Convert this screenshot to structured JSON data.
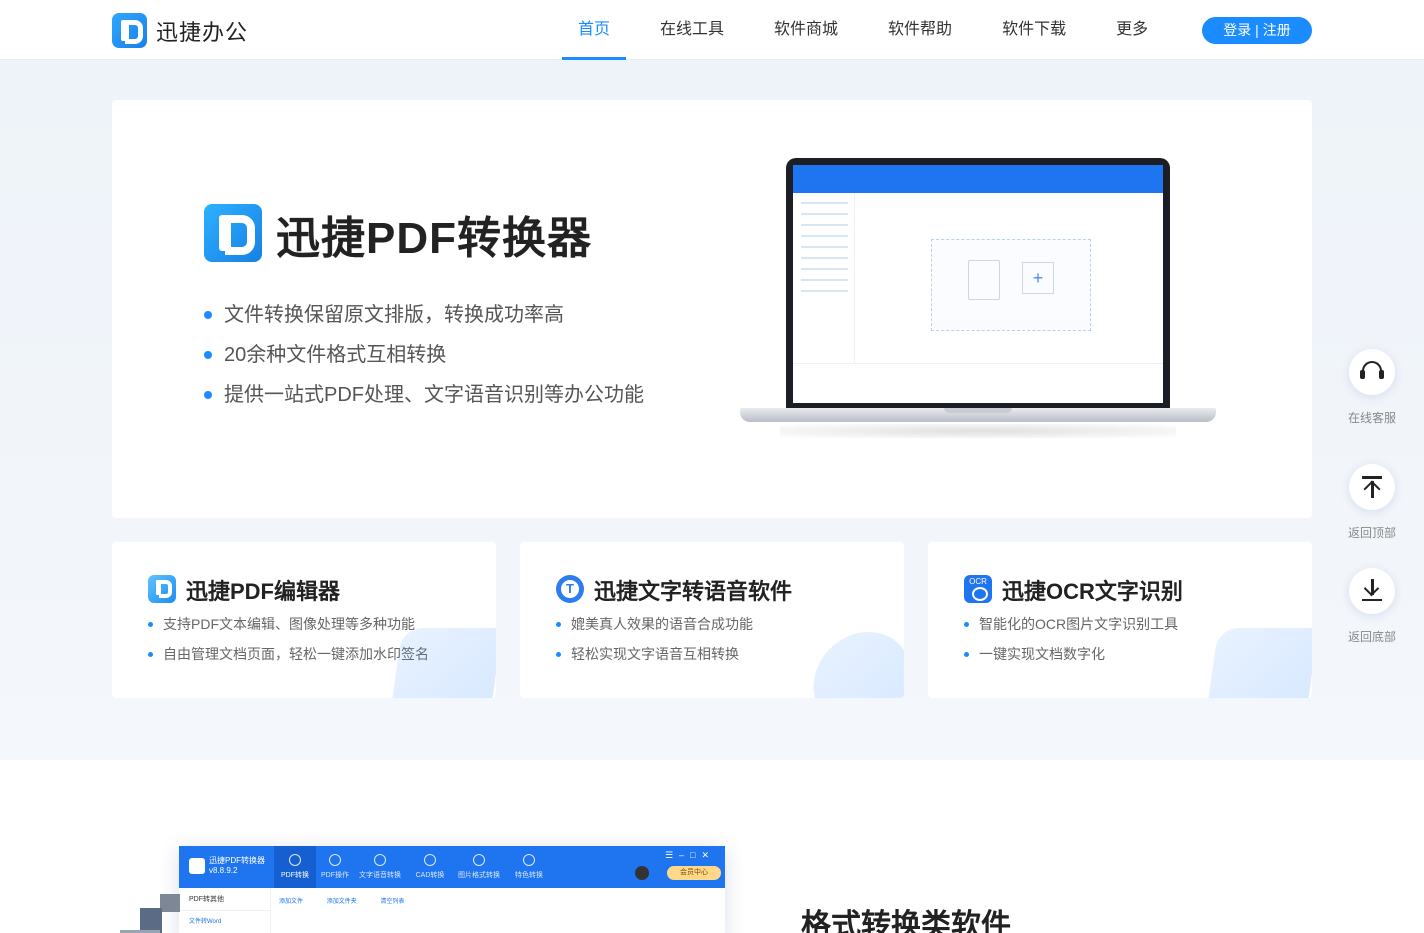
{
  "header": {
    "brand": "迅捷办公",
    "nav": [
      {
        "label": "首页",
        "active": true
      },
      {
        "label": "在线工具",
        "active": false
      },
      {
        "label": "软件商城",
        "active": false
      },
      {
        "label": "软件帮助",
        "active": false
      },
      {
        "label": "软件下载",
        "active": false
      },
      {
        "label": "更多",
        "active": false
      }
    ],
    "login_label": "登录 | 注册"
  },
  "hero": {
    "title": "迅捷PDF转换器",
    "features": [
      "文件转换保留原文排版，转换成功率高",
      "20余种文件格式互相转换",
      "提供一站式PDF处理、文字语音识别等办公功能"
    ]
  },
  "products": [
    {
      "icon": "pdf-editor-icon",
      "title": "迅捷PDF编辑器",
      "features": [
        "支持PDF文本编辑、图像处理等多种功能",
        "自由管理文档页面，轻松一键添加水印签名"
      ]
    },
    {
      "icon": "text-to-speech-icon",
      "title": "迅捷文字转语音软件",
      "features": [
        "媲美真人效果的语音合成功能",
        "轻松实现文字语音互相转换"
      ]
    },
    {
      "icon": "ocr-icon",
      "title": "迅捷OCR文字识别",
      "features": [
        "智能化的OCR图片文字识别工具",
        "一键实现文档数字化"
      ]
    }
  ],
  "app_preview": {
    "name": "迅捷PDF转换器",
    "version": "v8.8.9.2",
    "tabs": [
      "PDF转换",
      "PDF操作",
      "文字语音转换",
      "CAD转换",
      "图片格式转换",
      "特色转换"
    ],
    "vip_label": "会员中心",
    "sidebar_header": "PDF转其他",
    "sidebar_item": "文件转Word",
    "toolbar": [
      "添加文件",
      "添加文件夹",
      "清空列表"
    ]
  },
  "section": {
    "title": "格式转换类软件"
  },
  "float_bar": [
    {
      "icon": "headset-icon",
      "label": "在线客服"
    },
    {
      "icon": "back-to-top-icon",
      "label": "返回顶部"
    },
    {
      "icon": "back-to-bottom-icon",
      "label": "返回底部"
    }
  ],
  "colors": {
    "primary": "#1a8cff",
    "app_blue": "#1f74f0"
  }
}
